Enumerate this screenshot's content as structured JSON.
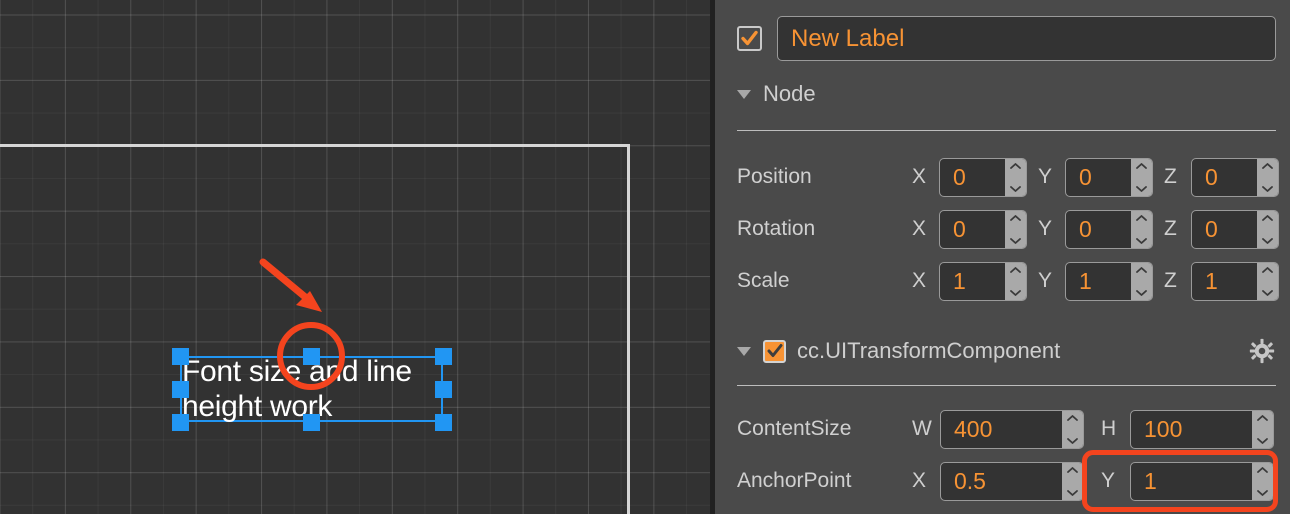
{
  "viewport": {
    "name": "scene-viewport",
    "background_color": "#323232",
    "canvas_border_color": "#d6d6d6",
    "selection_color": "#2196f3",
    "annotation_color": "#f4441e",
    "selected_node_text": "Font size and line height work"
  },
  "inspector": {
    "node_enabled": true,
    "node_name": "New Label",
    "name_placeholder": "Node name",
    "accent_color": "#f79334",
    "sections": [
      {
        "id": "node",
        "title": "Node",
        "expanded": true,
        "has_checkbox": false,
        "has_gear": false
      },
      {
        "id": "ui-transform",
        "title": "cc.UITransformComponent",
        "expanded": true,
        "has_checkbox": true,
        "checkbox_checked": true,
        "has_gear": true
      }
    ],
    "node_props": [
      {
        "label": "Position",
        "fields": [
          {
            "axis": "X",
            "value": "0"
          },
          {
            "axis": "Y",
            "value": "0"
          },
          {
            "axis": "Z",
            "value": "0"
          }
        ]
      },
      {
        "label": "Rotation",
        "fields": [
          {
            "axis": "X",
            "value": "0"
          },
          {
            "axis": "Y",
            "value": "0"
          },
          {
            "axis": "Z",
            "value": "0"
          }
        ]
      },
      {
        "label": "Scale",
        "fields": [
          {
            "axis": "X",
            "value": "1"
          },
          {
            "axis": "Y",
            "value": "1"
          },
          {
            "axis": "Z",
            "value": "1"
          }
        ]
      }
    ],
    "transform_props": [
      {
        "label": "ContentSize",
        "fields": [
          {
            "axis": "W",
            "value": "400"
          },
          {
            "axis": "H",
            "value": "100"
          }
        ]
      },
      {
        "label": "AnchorPoint",
        "fields": [
          {
            "axis": "X",
            "value": "0.5"
          },
          {
            "axis": "Y",
            "value": "1"
          }
        ]
      }
    ],
    "icons": {
      "collapse": "triangle-down-icon",
      "checkmark": "check-icon",
      "gear": "gear-icon",
      "spin_up": "chevron-up-icon",
      "spin_down": "chevron-down-icon"
    }
  }
}
